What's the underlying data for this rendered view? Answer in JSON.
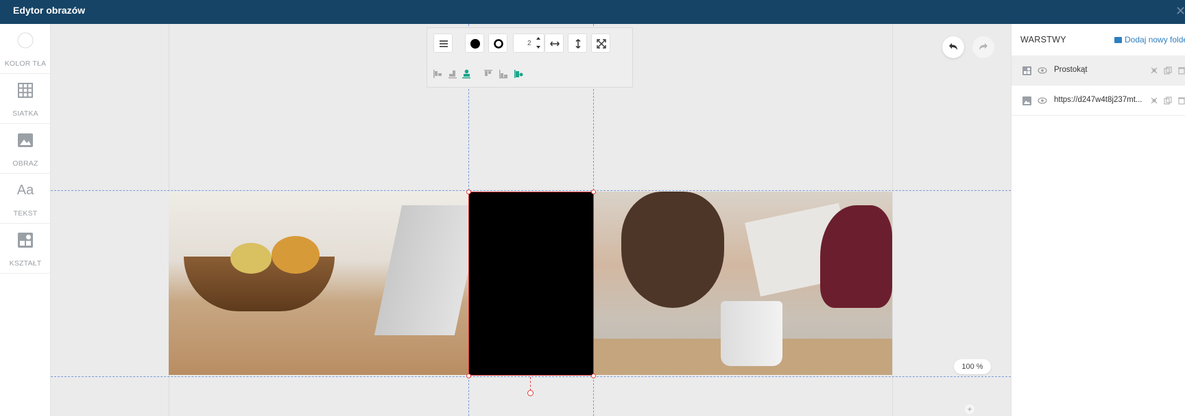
{
  "window": {
    "title": "Edytor obrazów",
    "close_icon": "close-icon"
  },
  "sidebar": {
    "items": [
      {
        "label": "KOLOR TŁA",
        "icon": "color-circle-icon"
      },
      {
        "label": "SIATKA",
        "icon": "grid-icon"
      },
      {
        "label": "OBRAZ",
        "icon": "image-icon"
      },
      {
        "label": "TEKST",
        "icon": "text-icon",
        "glyph": "Aa"
      },
      {
        "label": "KSZTAŁT",
        "icon": "shapes-icon"
      }
    ]
  },
  "toolbar": {
    "stroke_width": "2",
    "buttons": [
      "menu-icon",
      "fill-color-icon",
      "stroke-color-icon",
      "stretch-horizontal-icon",
      "stretch-vertical-icon",
      "fullscreen-icon"
    ],
    "align_buttons": [
      "align-left-icon",
      "align-center-h-icon",
      "align-right-icon",
      "align-top-icon",
      "align-center-v-icon",
      "align-bottom-icon"
    ]
  },
  "history": {
    "undo_icon": "undo-icon",
    "redo_icon": "redo-icon"
  },
  "canvas": {
    "zoom": "100 %",
    "zoom_in": "+",
    "selection_color": "#e03b3b",
    "guide_color": "#7a9ad8",
    "shape_fill": "#000000"
  },
  "layers": {
    "title": "WARSTWY",
    "add_folder": "Dodaj nowy folder",
    "items": [
      {
        "name": "Prostokąt",
        "type": "shape",
        "selected": true
      },
      {
        "name": "https://d247w4t8j237mt...",
        "type": "image",
        "selected": false
      }
    ]
  },
  "colors": {
    "titlebar": "#164466",
    "accent": "#2f7fc0",
    "active_tool": "#1aa58a"
  }
}
